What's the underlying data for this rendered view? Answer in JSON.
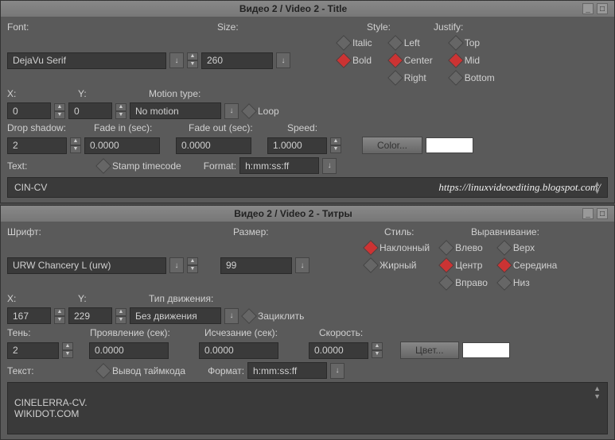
{
  "win1": {
    "title": "Видео 2 / Video 2 - Title",
    "labels": {
      "font": "Font:",
      "size": "Size:",
      "style": "Style:",
      "justify": "Justify:",
      "x": "X:",
      "y": "Y:",
      "motion": "Motion type:",
      "loop": "Loop",
      "shadow": "Drop shadow:",
      "fadein": "Fade in (sec):",
      "fadeout": "Fade out (sec):",
      "speed": "Speed:",
      "stamp": "Stamp timecode",
      "format": "Format:",
      "text": "Text:",
      "color": "Color...",
      "italic": "Italic",
      "bold": "Bold",
      "left": "Left",
      "center": "Center",
      "right": "Right",
      "top": "Top",
      "mid": "Mid",
      "bottom": "Bottom"
    },
    "values": {
      "font": "DejaVu Serif",
      "size": "260",
      "x": "0",
      "y": "0",
      "motion": "No motion",
      "shadow": "2",
      "fadein": "0.0000",
      "fadeout": "0.0000",
      "speed": "1.0000",
      "format": "h:mm:ss:ff",
      "text": "CIN-CV"
    },
    "url": "https://linuxvideoediting.blogspot.com/"
  },
  "win2": {
    "title": "Видео 2 / Video 2 - Титры",
    "labels": {
      "font": "Шрифт:",
      "size": "Размер:",
      "style": "Стиль:",
      "justify": "Выравнивание:",
      "x": "X:",
      "y": "Y:",
      "motion": "Тип движения:",
      "loop": "Зациклить",
      "shadow": "Тень:",
      "fadein": "Проявление (сек):",
      "fadeout": "Исчезание (сек):",
      "speed": "Скорость:",
      "stamp": "Вывод таймкода",
      "format": "Формат:",
      "text": "Текст:",
      "color": "Цвет...",
      "italic": "Наклонный",
      "bold": "Жирный",
      "left": "Влево",
      "center": "Центр",
      "right": "Вправо",
      "top": "Верх",
      "mid": "Середина",
      "bottom": "Низ"
    },
    "values": {
      "font": "URW Chancery L (urw)",
      "size": "99",
      "x": "167",
      "y": "229",
      "motion": "Без движения",
      "shadow": "2",
      "fadein": "0.0000",
      "fadeout": "0.0000",
      "speed": "0.0000",
      "format": "h:mm:ss:ff",
      "text": "CINELERRA-CV.\nWIKIDOT.COM"
    }
  }
}
